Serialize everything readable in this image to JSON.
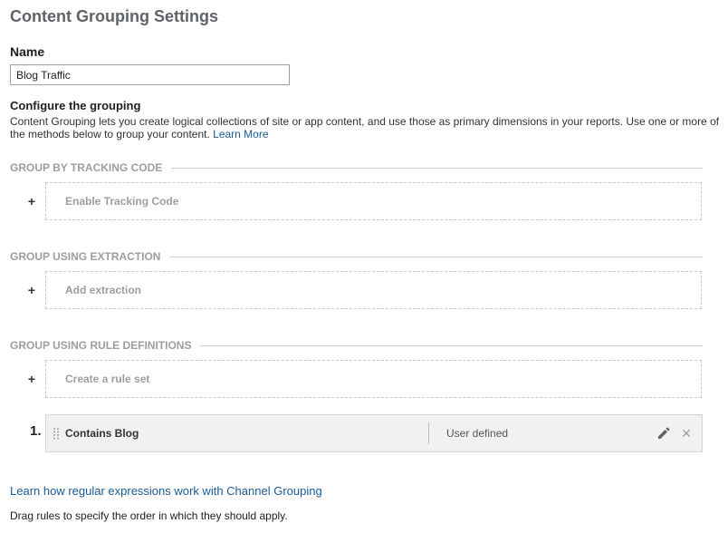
{
  "page": {
    "title": "Content Grouping Settings"
  },
  "name_field": {
    "label": "Name",
    "value": "Blog Traffic"
  },
  "configure": {
    "title": "Configure the grouping",
    "description": "Content Grouping lets you create logical collections of site or app content, and use those as primary dimensions in your reports. Use one or more of the methods below to group your content.",
    "learn_more": "Learn More"
  },
  "sections": {
    "tracking": {
      "header": "GROUP BY TRACKING CODE",
      "action": "Enable Tracking Code",
      "plus": "+"
    },
    "extraction": {
      "header": "GROUP USING EXTRACTION",
      "action": "Add extraction",
      "plus": "+"
    },
    "rules": {
      "header": "GROUP USING RULE DEFINITIONS",
      "action": "Create a rule set",
      "plus": "+"
    }
  },
  "rule_list": [
    {
      "number": "1.",
      "name": "Contains Blog",
      "type": "User defined"
    }
  ],
  "icons": {
    "drag": "drag-handle-icon",
    "edit": "pencil-icon",
    "delete": "close-icon"
  },
  "footer": {
    "regex_link": "Learn how regular expressions work with Channel Grouping",
    "drag_note": "Drag rules to specify the order in which they should apply."
  },
  "colors": {
    "link": "#1a5b97",
    "section_header": "#9e9e9e",
    "rule_row_bg": "#f1f1f1"
  }
}
